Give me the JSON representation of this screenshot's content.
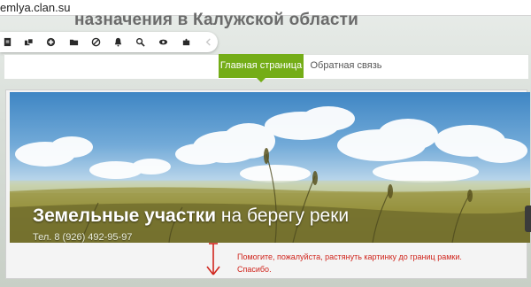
{
  "browser": {
    "url": "emlya.clan.su"
  },
  "site": {
    "title": "назначения в Калужской области"
  },
  "toolbar": {
    "icons": [
      "document-icon",
      "layers-icon",
      "add-icon",
      "folder-icon",
      "block-icon",
      "bell-icon",
      "search-icon",
      "eye-icon",
      "puzzle-icon",
      "chevron-left-icon"
    ]
  },
  "nav": {
    "home_label": "Главная страница",
    "feedback_label": "Обратная связь",
    "active_color": "#74ad17"
  },
  "banner": {
    "title_bold": "Земельные участки",
    "title_rest": " на берегу реки",
    "phone": "Тел. 8 (926) 492-95-97"
  },
  "annotation": {
    "note_line1": "Помогите, пожалуйста, растянуть картинку до границ рамки.",
    "note_line2": "Спасибо.",
    "color": "#d0261e"
  }
}
